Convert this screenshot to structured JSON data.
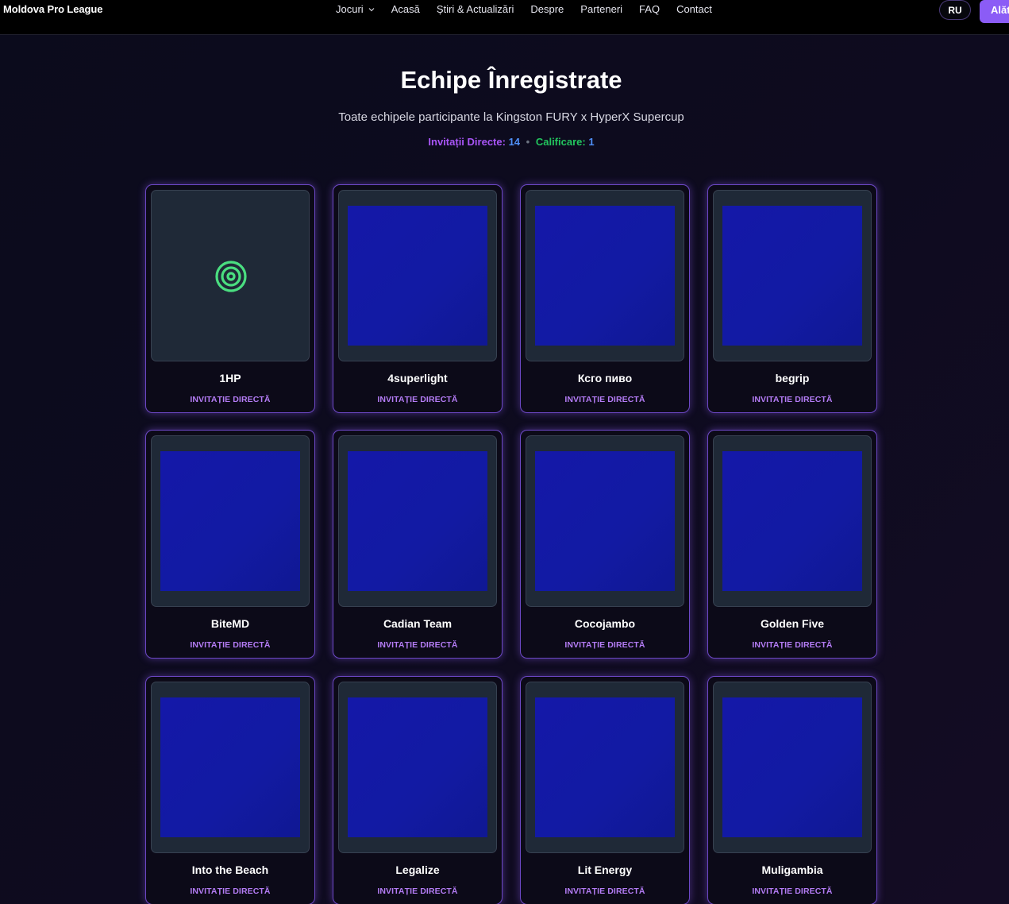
{
  "nav": {
    "brand": "Moldova Pro League",
    "links": [
      {
        "label": "Jocuri",
        "dropdown": true
      },
      {
        "label": "Acasă"
      },
      {
        "label": "Știri & Actualizări"
      },
      {
        "label": "Despre"
      },
      {
        "label": "Parteneri"
      },
      {
        "label": "FAQ"
      },
      {
        "label": "Contact"
      }
    ],
    "lang_label": "RU",
    "cta_label": "Alătură-te"
  },
  "header": {
    "title": "Echipe Înregistrate",
    "subtitle": "Toate echipele participante la Kingston FURY x HyperX Supercup",
    "direct_label": "Invitații Directe:",
    "direct_count": "14",
    "separator": "•",
    "qual_label": "Calificare:",
    "qual_count": "1"
  },
  "teams": [
    {
      "name": "1HP",
      "badge": "INVITAȚIE DIRECTĂ",
      "logo": "target-icon"
    },
    {
      "name": "4superlight",
      "badge": "INVITAȚIE DIRECTĂ",
      "logo": "image"
    },
    {
      "name": "Ксго пиво",
      "badge": "INVITAȚIE DIRECTĂ",
      "logo": "image"
    },
    {
      "name": "begrip",
      "badge": "INVITAȚIE DIRECTĂ",
      "logo": "image"
    },
    {
      "name": "BiteMD",
      "badge": "INVITAȚIE DIRECTĂ",
      "logo": "image"
    },
    {
      "name": "Cadian Team",
      "badge": "INVITAȚIE DIRECTĂ",
      "logo": "image"
    },
    {
      "name": "Cocojambo",
      "badge": "INVITAȚIE DIRECTĂ",
      "logo": "image"
    },
    {
      "name": "Golden Five",
      "badge": "INVITAȚIE DIRECTĂ",
      "logo": "image"
    },
    {
      "name": "Into the Beach",
      "badge": "INVITAȚIE DIRECTĂ",
      "logo": "image"
    },
    {
      "name": "Legalize",
      "badge": "INVITAȚIE DIRECTĂ",
      "logo": "image"
    },
    {
      "name": "Lit Energy",
      "badge": "INVITAȚIE DIRECTĂ",
      "logo": "image"
    },
    {
      "name": "Muligambia",
      "badge": "INVITAȚIE DIRECTĂ",
      "logo": "image"
    }
  ],
  "colors": {
    "accent": "#8b5cf6",
    "badge": "#b47cf5",
    "direct": "#a855f7",
    "qualification": "#22c55e",
    "count": "#4f8ff7",
    "logo_placeholder": "#1418a8",
    "target_icon": "#4ade80"
  }
}
